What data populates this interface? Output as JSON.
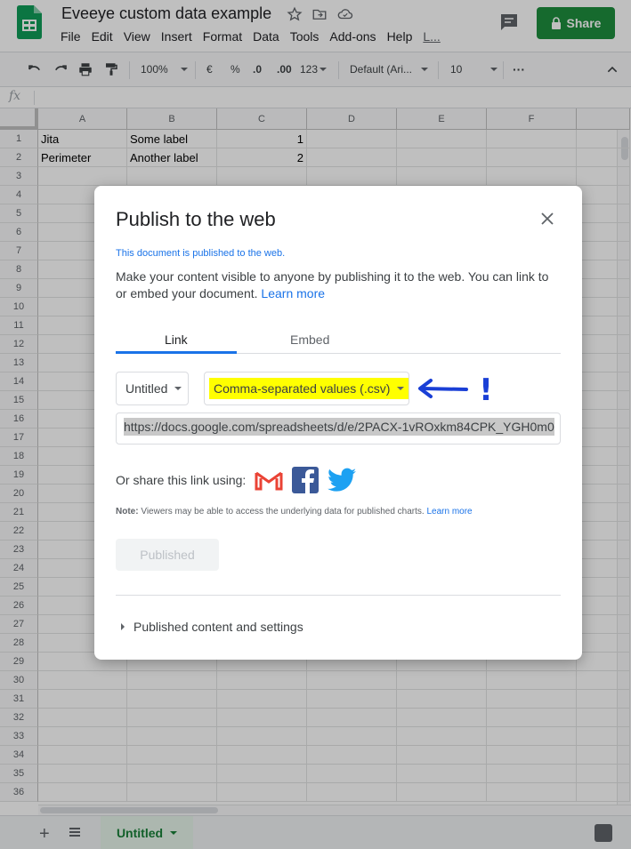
{
  "app": {
    "doc_title": "Eveeye custom data example",
    "menu": [
      "File",
      "Edit",
      "View",
      "Insert",
      "Format",
      "Data",
      "Tools",
      "Add-ons",
      "Help",
      "L..."
    ],
    "share_label": "Share",
    "colors": {
      "share_green": "#1e8e3e",
      "accent_blue": "#1a73e8",
      "sheet_tab_green": "#188038",
      "highlight_yellow": "#ffff00"
    }
  },
  "toolbar": {
    "zoom": "100%",
    "currency": "€",
    "percent": "%",
    "decimal_less": ".0",
    "decimal_more": ".00",
    "number_format": "123",
    "font": "Default (Ari...",
    "font_size": "10",
    "more": "···"
  },
  "formula_bar": {
    "fx_label": "fx"
  },
  "grid": {
    "columns": [
      "A",
      "B",
      "C",
      "D",
      "E",
      "F"
    ],
    "row_numbers": [
      "1",
      "2",
      "3",
      "4",
      "5",
      "6",
      "7",
      "8",
      "9",
      "10",
      "11",
      "12",
      "13",
      "14",
      "15",
      "16",
      "17",
      "18",
      "19",
      "20",
      "21",
      "22",
      "23",
      "24",
      "25",
      "26",
      "27",
      "28",
      "29",
      "30",
      "31",
      "32",
      "33",
      "34",
      "35",
      "36"
    ],
    "rows": [
      [
        "Jita",
        "Some label",
        "1"
      ],
      [
        "Perimeter",
        "Another label",
        "2"
      ]
    ]
  },
  "sheets": {
    "add_icon": "plus-icon",
    "list_icon": "list-icon",
    "active_tab": "Untitled"
  },
  "dialog": {
    "title": "Publish to the web",
    "status": "This document is published to the web.",
    "description": "Make your content visible to anyone by publishing it to the web. You can link to or embed your document.",
    "learn_more": "Learn more",
    "tabs": [
      "Link",
      "Embed"
    ],
    "sheet_select": "Untitled",
    "format_select": "Comma-separated values (.csv)",
    "annotation_mark": "!",
    "url": "https://docs.google.com/spreadsheets/d/e/2PACX-1vROxkm84CPK_YGH0m0",
    "share_label": "Or share this link using:",
    "share_icons": [
      "gmail-icon",
      "facebook-icon",
      "twitter-icon"
    ],
    "note_bold": "Note:",
    "note_text": "Viewers may be able to access the underlying data for published charts.",
    "note_link": "Learn more",
    "published_button": "Published",
    "expander_label": "Published content and settings"
  }
}
